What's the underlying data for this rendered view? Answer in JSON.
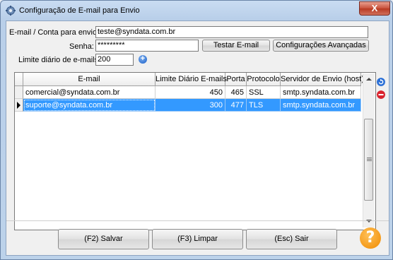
{
  "window": {
    "title": "Configuração de E-mail para Envio",
    "close_label": "X"
  },
  "form": {
    "email_label": "E-mail / Conta para envio:",
    "email_value": "teste@syndata.com.br",
    "password_label": "Senha:",
    "password_value": "*********",
    "test_button": "Testar E-mail",
    "advanced_button": "Configurações Avançadas",
    "limit_label": "Limite diário de e-mails:",
    "limit_value": "200"
  },
  "table": {
    "columns": [
      "E-mail",
      "Limite Diário E-mails",
      "Porta",
      "Protocolo",
      "Servidor de Envio (host)"
    ],
    "rows": [
      {
        "email": "comercial@syndata.com.br",
        "limit": "450",
        "port": "465",
        "protocol": "SSL",
        "host": "smtp.syndata.com.br",
        "selected": false
      },
      {
        "email": "suporte@syndata.com.br",
        "limit": "300",
        "port": "477",
        "protocol": "TLS",
        "host": "smtp.syndata.com.br",
        "selected": true
      }
    ]
  },
  "footer": {
    "save_button": "(F2) Salvar",
    "clear_button": "(F3) Limpar",
    "exit_button": "(Esc) Sair",
    "help_label": "?"
  },
  "colors": {
    "selection": "#3399ff",
    "close": "#c8503a",
    "help": "#f08a00",
    "add_icon": "#1a5fc8",
    "remove_icon": "#d9232e"
  }
}
